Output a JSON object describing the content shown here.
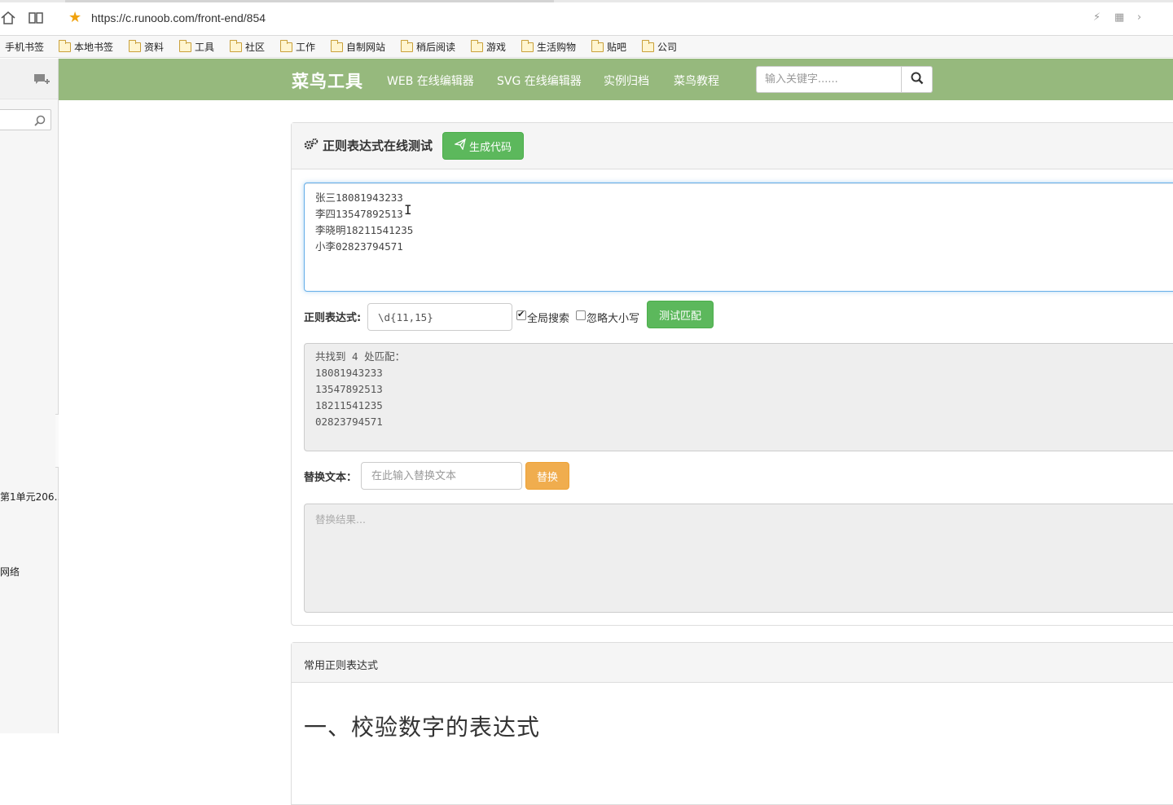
{
  "browser": {
    "url": "https://c.runoob.com/front-end/854"
  },
  "bookmarks": {
    "items": [
      "手机书签",
      "本地书签",
      "资料",
      "工具",
      "社区",
      "工作",
      "自制网站",
      "稍后阅读",
      "游戏",
      "生活购物",
      "贴吧",
      "公司"
    ]
  },
  "sidebar": {
    "entries": [
      "第1单元206…",
      "网络"
    ]
  },
  "navbar": {
    "brand": "菜鸟工具",
    "links": [
      "WEB 在线编辑器",
      "SVG 在线编辑器",
      "实例归档",
      "菜鸟教程"
    ],
    "search_placeholder": "输入关键字......",
    "bg_color": "#96b97d"
  },
  "tool": {
    "title": "正则表达式在线测试",
    "generate_button": "生成代码",
    "source_lines": [
      "张三18081943233",
      "李四13547892513",
      "李晓明18211541235",
      "小李02823794571"
    ],
    "regex_label": "正则表达式:",
    "regex_value": "\\d{11,15}",
    "global_label": "全局搜索",
    "global_checked": true,
    "ignore_case_label": "忽略大小写",
    "ignore_case_checked": false,
    "test_button": "测试匹配",
    "result_lines": [
      "共找到 4 处匹配：",
      "18081943233",
      "13547892513",
      "18211541235",
      "02823794571"
    ],
    "replace_label": "替换文本：",
    "replace_placeholder": "在此输入替换文本",
    "replace_button": "替换",
    "replace_result_placeholder": "替换结果..."
  },
  "common": {
    "heading": "常用正则表达式",
    "section_title": "一、校验数字的表达式"
  },
  "colors": {
    "success": "#5cb85c",
    "warning": "#f0ad4e",
    "focus_border": "#66afe9"
  }
}
